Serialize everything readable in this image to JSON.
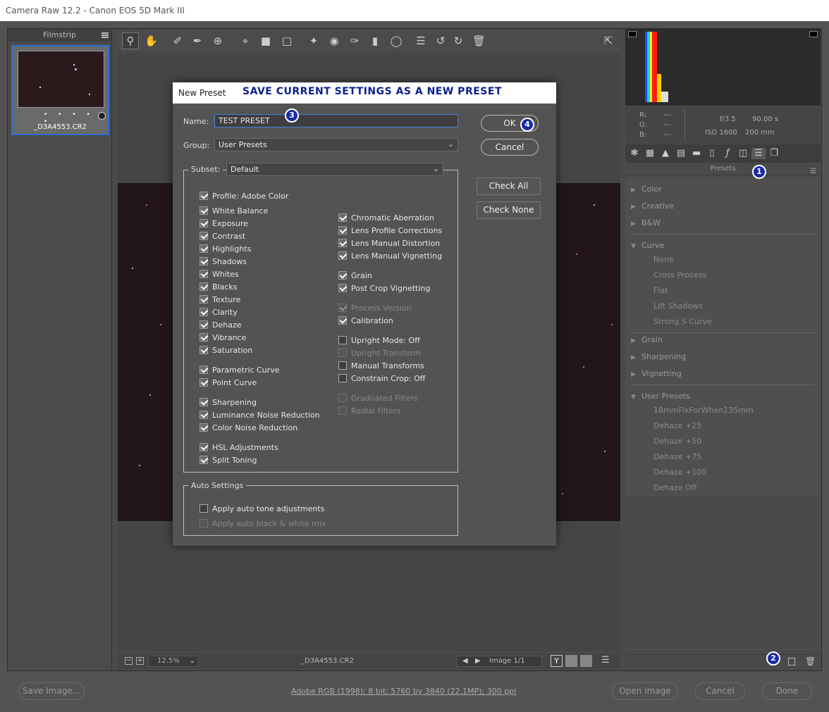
{
  "window": {
    "title": "Camera Raw 12.2  -  Canon EOS 5D Mark III"
  },
  "filmstrip": {
    "header": "Filmstrip",
    "thumb_name": "_D3A4553.CR2",
    "rating_dots": "• • • • •"
  },
  "preview": {
    "zoom": "12.5%",
    "filename": "_D3A4553.CR2",
    "image_counter": "Image 1/1",
    "zoom_minus": "−",
    "zoom_plus": "+"
  },
  "info": {
    "r_label": "R:",
    "g_label": "G:",
    "b_label": "B:",
    "r": "---",
    "g": "---",
    "b": "---",
    "aperture": "f/3.5",
    "shutter": "90.00 s",
    "iso": "ISO 1600",
    "focal": "200 mm"
  },
  "presets_panel": {
    "header": "Presets",
    "groups_top": [
      "Color",
      "Creative",
      "B&W"
    ],
    "curve_label": "Curve",
    "curve_items": [
      "None",
      "Cross Process",
      "Flat",
      "Lift Shadows",
      "Strong S Curve"
    ],
    "groups_mid": [
      "Grain",
      "Sharpening",
      "Vignetting"
    ],
    "user_label": "User Presets",
    "user_items": [
      "18mmFixForWhen135mm",
      "Dehaze +25",
      "Dehaze +50",
      "Dehaze +75",
      "Dehaze +100",
      "Dehaze Off"
    ]
  },
  "footer": {
    "save_image": "Save Image...",
    "workflow": "Adobe RGB (1998); 8 bit; 5760 by 3840 (22.1MP); 300 ppi",
    "open_image": "Open Image",
    "cancel": "Cancel",
    "done": "Done"
  },
  "dialog": {
    "title": "New Preset",
    "banner": "SAVE CURRENT SETTINGS AS A NEW PRESET",
    "name_label": "Name:",
    "name_value": "TEST PRESET",
    "group_label": "Group:",
    "group_value": "User Presets",
    "subset_label": "Subset:",
    "subset_value": "Default",
    "ok": "OK",
    "cancel": "Cancel",
    "check_all": "Check All",
    "check_none": "Check None",
    "auto_settings_label": "Auto Settings",
    "left_checks": [
      {
        "label": "Profile: Adobe Color",
        "checked": true
      },
      {
        "label": "White Balance",
        "checked": true
      },
      {
        "label": "Exposure",
        "checked": true
      },
      {
        "label": "Contrast",
        "checked": true
      },
      {
        "label": "Highlights",
        "checked": true
      },
      {
        "label": "Shadows",
        "checked": true
      },
      {
        "label": "Whites",
        "checked": true
      },
      {
        "label": "Blacks",
        "checked": true
      },
      {
        "label": "Texture",
        "checked": true
      },
      {
        "label": "Clarity",
        "checked": true
      },
      {
        "label": "Dehaze",
        "checked": true
      },
      {
        "label": "Vibrance",
        "checked": true
      },
      {
        "label": "Saturation",
        "checked": true
      },
      {
        "label": "Parametric Curve",
        "checked": true
      },
      {
        "label": "Point Curve",
        "checked": true
      },
      {
        "label": "Sharpening",
        "checked": true
      },
      {
        "label": "Luminance Noise Reduction",
        "checked": true
      },
      {
        "label": "Color Noise Reduction",
        "checked": true
      },
      {
        "label": "HSL Adjustments",
        "checked": true
      },
      {
        "label": "Split Toning",
        "checked": true
      }
    ],
    "right_checks": [
      {
        "label": "Chromatic Aberration",
        "checked": true,
        "disabled": false
      },
      {
        "label": "Lens Profile Corrections",
        "checked": true,
        "disabled": false
      },
      {
        "label": "Lens Manual Distortion",
        "checked": true,
        "disabled": false
      },
      {
        "label": "Lens Manual Vignetting",
        "checked": true,
        "disabled": false
      },
      {
        "label": "Grain",
        "checked": true,
        "disabled": false
      },
      {
        "label": "Post Crop Vignetting",
        "checked": true,
        "disabled": false
      },
      {
        "label": "Process Version",
        "checked": true,
        "disabled": true
      },
      {
        "label": "Calibration",
        "checked": true,
        "disabled": false
      },
      {
        "label": "Upright Mode: Off",
        "checked": false,
        "disabled": false
      },
      {
        "label": "Upright Transform",
        "checked": false,
        "disabled": true
      },
      {
        "label": "Manual Transforms",
        "checked": false,
        "disabled": false
      },
      {
        "label": "Constrain Crop: Off",
        "checked": false,
        "disabled": false
      },
      {
        "label": "Graduated Filters",
        "checked": false,
        "disabled": true
      },
      {
        "label": "Radial Filters",
        "checked": false,
        "disabled": true
      }
    ],
    "auto_checks": [
      {
        "label": "Apply auto tone adjustments",
        "checked": false,
        "disabled": false
      },
      {
        "label": "Apply auto black & white mix",
        "checked": false,
        "disabled": true
      }
    ]
  },
  "callouts": [
    "1",
    "2",
    "3",
    "4"
  ],
  "colors": {
    "accent": "#2d6fd2",
    "callout": "#1a2aa8",
    "banner": "#0a1f8f"
  }
}
